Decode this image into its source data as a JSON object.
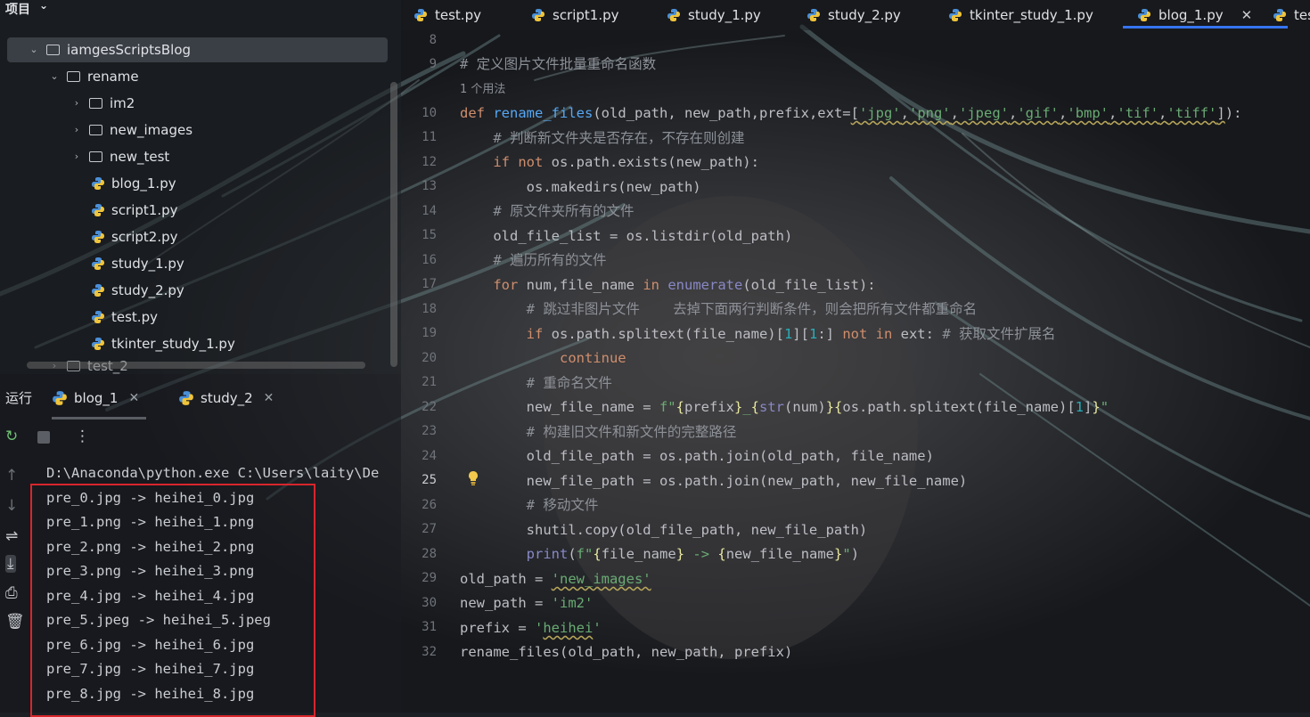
{
  "project_panel": {
    "title": "项目",
    "tree": [
      {
        "label": "iamgesScriptsBlog",
        "kind": "folder",
        "depth": 1,
        "expanded": true,
        "selected": true
      },
      {
        "label": "rename",
        "kind": "folder",
        "depth": 2,
        "expanded": true
      },
      {
        "label": "im2",
        "kind": "folder",
        "depth": 3,
        "expanded": false
      },
      {
        "label": "new_images",
        "kind": "folder",
        "depth": 3,
        "expanded": false
      },
      {
        "label": "new_test",
        "kind": "folder",
        "depth": 3,
        "expanded": false
      },
      {
        "label": "blog_1.py",
        "kind": "python",
        "depth": 3
      },
      {
        "label": "script1.py",
        "kind": "python",
        "depth": 3
      },
      {
        "label": "script2.py",
        "kind": "python",
        "depth": 3
      },
      {
        "label": "study_1.py",
        "kind": "python",
        "depth": 3
      },
      {
        "label": "study_2.py",
        "kind": "python",
        "depth": 3
      },
      {
        "label": "test.py",
        "kind": "python",
        "depth": 3
      },
      {
        "label": "tkinter_study_1.py",
        "kind": "python",
        "depth": 3
      },
      {
        "label": "test_2",
        "kind": "folder",
        "depth": 2,
        "expanded": false
      }
    ]
  },
  "run_panel": {
    "title": "运行",
    "tabs": [
      {
        "label": "blog_1",
        "active": true
      },
      {
        "label": "study_2",
        "active": false
      }
    ],
    "console_lines": [
      "D:\\Anaconda\\python.exe C:\\Users\\laity\\De",
      "pre_0.jpg -> heihei_0.jpg",
      "pre_1.png -> heihei_1.png",
      "pre_2.png -> heihei_2.png",
      "pre_3.png -> heihei_3.png",
      "pre_4.jpg -> heihei_4.jpg",
      "pre_5.jpeg -> heihei_5.jpeg",
      "pre_6.jpg -> heihei_6.jpg",
      "pre_7.jpg -> heihei_7.jpg",
      "pre_8.jpg -> heihei_8.jpg"
    ]
  },
  "editor": {
    "tabs": [
      {
        "label": "test.py",
        "active": false
      },
      {
        "label": "script1.py",
        "active": false
      },
      {
        "label": "study_1.py",
        "active": false
      },
      {
        "label": "study_2.py",
        "active": false
      },
      {
        "label": "tkinter_study_1.py",
        "active": false
      },
      {
        "label": "blog_1.py",
        "active": true
      },
      {
        "label": "tes",
        "active": false
      }
    ],
    "current_line": "25",
    "usage_hint": "1 个用法",
    "line_numbers": [
      "8",
      "9",
      "10",
      "11",
      "12",
      "13",
      "14",
      "15",
      "16",
      "17",
      "18",
      "19",
      "20",
      "21",
      "22",
      "23",
      "24",
      "25",
      "26",
      "27",
      "28",
      "29",
      "30",
      "31",
      "32"
    ]
  },
  "colors": {
    "accent": "#3574f0",
    "highlight_box": "#d7262b",
    "keyword": "#cf8e6d",
    "function": "#56a8f5",
    "string": "#6aab73",
    "comment": "#8d9198"
  }
}
